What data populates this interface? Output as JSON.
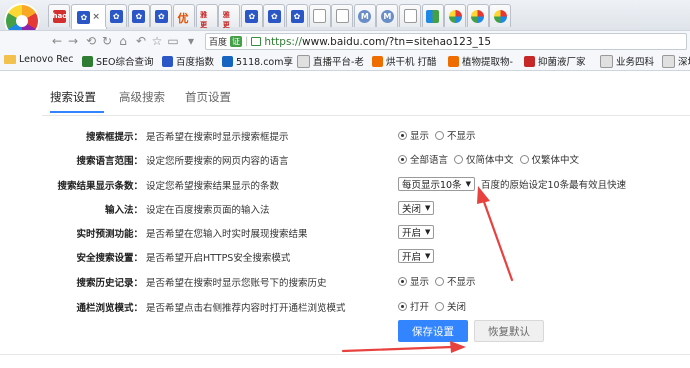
{
  "browser": {
    "address": {
      "site_badge": "百度",
      "ev_badge": "证",
      "url_scheme": "https://",
      "url_rest": "www.baidu.com/?tn=sitehao123_15"
    },
    "tabs": [
      {
        "icon": "hao-icon",
        "glyph": "hao"
      },
      {
        "icon": "baidu-paw-icon",
        "glyph": "✿",
        "active": true,
        "close": "×"
      },
      {
        "icon": "baidu-paw-icon",
        "glyph": "✿"
      },
      {
        "icon": "baidu-paw-icon",
        "glyph": "✿"
      },
      {
        "icon": "baidu-paw-icon",
        "glyph": "✿"
      },
      {
        "icon": "you-icon",
        "glyph": "优"
      },
      {
        "icon": "red-logo-icon",
        "glyph": "雅更"
      },
      {
        "icon": "red-logo-icon",
        "glyph": "雅更"
      },
      {
        "icon": "baidu-paw-icon",
        "glyph": "✿"
      },
      {
        "icon": "baidu-paw-icon",
        "glyph": "✿"
      },
      {
        "icon": "baidu-paw-icon",
        "glyph": "✿"
      },
      {
        "icon": "document-icon",
        "glyph": ""
      },
      {
        "icon": "document-icon",
        "glyph": ""
      },
      {
        "icon": "m-icon",
        "glyph": "M"
      },
      {
        "icon": "m-icon",
        "glyph": "M"
      },
      {
        "icon": "document-icon",
        "glyph": ""
      },
      {
        "icon": "windows-icon",
        "glyph": ""
      },
      {
        "icon": "color-pie-icon",
        "glyph": ""
      },
      {
        "icon": "color-pie-icon",
        "glyph": ""
      },
      {
        "icon": "color-pie-icon",
        "glyph": ""
      }
    ],
    "bookmarks": [
      {
        "label": "Lenovo Rec",
        "icon": "folder-icon"
      },
      {
        "label": "SEO综合查询",
        "icon": "seo-icon"
      },
      {
        "label": "百度指数",
        "icon": "baidu-icon"
      },
      {
        "label": "5118.com享",
        "icon": "5118-icon"
      },
      {
        "label": "直播平台-老",
        "icon": "document-icon"
      },
      {
        "label": "烘干机 打醋",
        "icon": "orange-icon"
      },
      {
        "label": "植物提取物-",
        "icon": "orange-icon"
      },
      {
        "label": "抑菌液厂家",
        "icon": "red-icon"
      },
      {
        "label": "业务四科",
        "icon": "document-icon"
      },
      {
        "label": "深圳",
        "icon": "document-icon"
      }
    ]
  },
  "settings": {
    "tabs": [
      {
        "label": "搜索设置",
        "active": true
      },
      {
        "label": "高级搜索",
        "active": false
      },
      {
        "label": "首页设置",
        "active": false
      }
    ],
    "rows": [
      {
        "label": "搜索框提示：",
        "desc": "是否希望在搜索时显示搜索框提示",
        "type": "radio",
        "options": [
          "显示",
          "不显示"
        ],
        "selected": 0
      },
      {
        "label": "搜索语言范围：",
        "desc": "设定您所要搜索的网页内容的语言",
        "type": "radio",
        "options": [
          "全部语言",
          "仅简体中文",
          "仅繁体中文"
        ],
        "selected": 0
      },
      {
        "label": "搜索结果显示条数：",
        "desc": "设定您希望搜索结果显示的条数",
        "type": "select",
        "value": "每页显示10条",
        "note": "百度的原始设定10条最有效且快速"
      },
      {
        "label": "输入法：",
        "desc": "设定在百度搜索页面的输入法",
        "type": "select",
        "value": "关闭"
      },
      {
        "label": "实时预测功能：",
        "desc": "是否希望在您输入时实时展现搜索结果",
        "type": "select",
        "value": "开启"
      },
      {
        "label": "安全搜索设置：",
        "desc": "是否希望开启HTTPS安全搜索模式",
        "type": "select",
        "value": "开启"
      },
      {
        "label": "搜索历史记录：",
        "desc": "是否希望在搜索时显示您账号下的搜索历史",
        "type": "radio",
        "options": [
          "显示",
          "不显示"
        ],
        "selected": 0
      },
      {
        "label": "通栏浏览模式：",
        "desc": "是否希望点击右侧推荐内容时打开通栏浏览模式",
        "type": "radio",
        "options": [
          "打开",
          "关闭"
        ],
        "selected": 0
      }
    ],
    "save_label": "保存设置",
    "reset_label": "恢复默认"
  },
  "colors": {
    "accent": "#3385ff",
    "annotation_arrow": "#e8423f"
  }
}
